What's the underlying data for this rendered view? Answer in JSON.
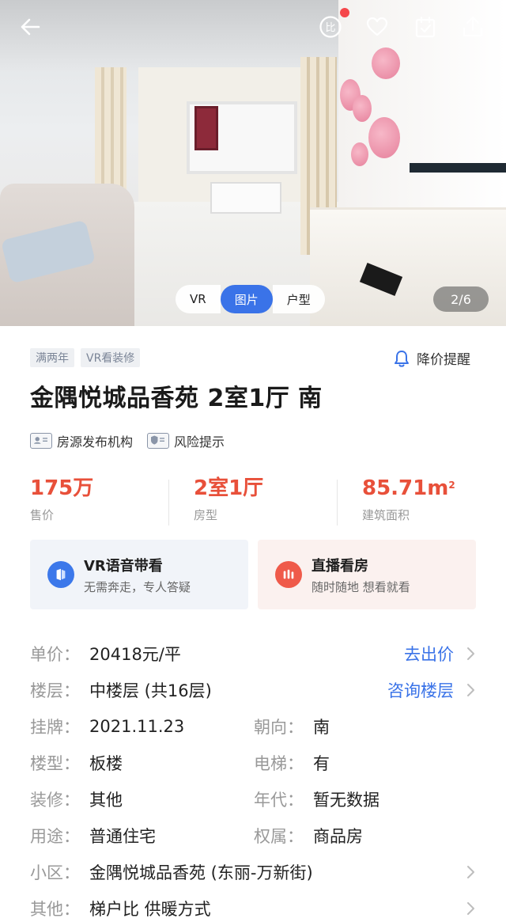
{
  "photo": {
    "tabs": [
      "VR",
      "图片",
      "户型"
    ],
    "active_tab": "图片",
    "counter": "2/6"
  },
  "topbar": {
    "back_icon": "back-arrow-icon",
    "compare_icon_text": "比",
    "icons": [
      "compare-icon",
      "heart-icon",
      "calendar-check-icon",
      "share-icon"
    ],
    "badge_color": "#f5474b"
  },
  "listing": {
    "tags": [
      "满两年",
      "VR看装修"
    ],
    "price_alert": "降价提醒",
    "title": "金隅悦城品香苑 2室1厅 南",
    "info_links": [
      "房源发布机构",
      "风险提示"
    ]
  },
  "stats": [
    {
      "value": "175万",
      "label": "售价"
    },
    {
      "value": "2室1厅",
      "label": "房型"
    },
    {
      "value": "85.71m",
      "sup": "2",
      "label": "建筑面积"
    }
  ],
  "cards": {
    "vr": {
      "title": "VR语音带看",
      "subtitle": "无需奔走，专人答疑"
    },
    "live": {
      "title": "直播看房",
      "subtitle": "随时随地 想看就看"
    }
  },
  "details": {
    "unit_price": {
      "key": "单价：",
      "value": "20418元/平",
      "action": "去出价"
    },
    "floor": {
      "key": "楼层：",
      "value": "中楼层 (共16层)",
      "action": "咨询楼层"
    },
    "listed": {
      "key": "挂牌：",
      "value": "2021.11.23",
      "key2": "朝向：",
      "value2": "南"
    },
    "building": {
      "key": "楼型：",
      "value": "板楼",
      "key2": "电梯：",
      "value2": "有"
    },
    "decoration": {
      "key": "装修：",
      "value": "其他",
      "key2": "年代：",
      "value2": "暂无数据"
    },
    "usage": {
      "key": "用途：",
      "value": "普通住宅",
      "key2": "权属：",
      "value2": "商品房"
    },
    "community": {
      "key": "小区：",
      "value": "金隅悦城品香苑 (东丽-万新街)"
    },
    "other": {
      "key": "其他：",
      "value": "梯户比 供暖方式"
    }
  },
  "colors": {
    "accent_blue": "#3a73e8",
    "price_red": "#e8503a"
  }
}
